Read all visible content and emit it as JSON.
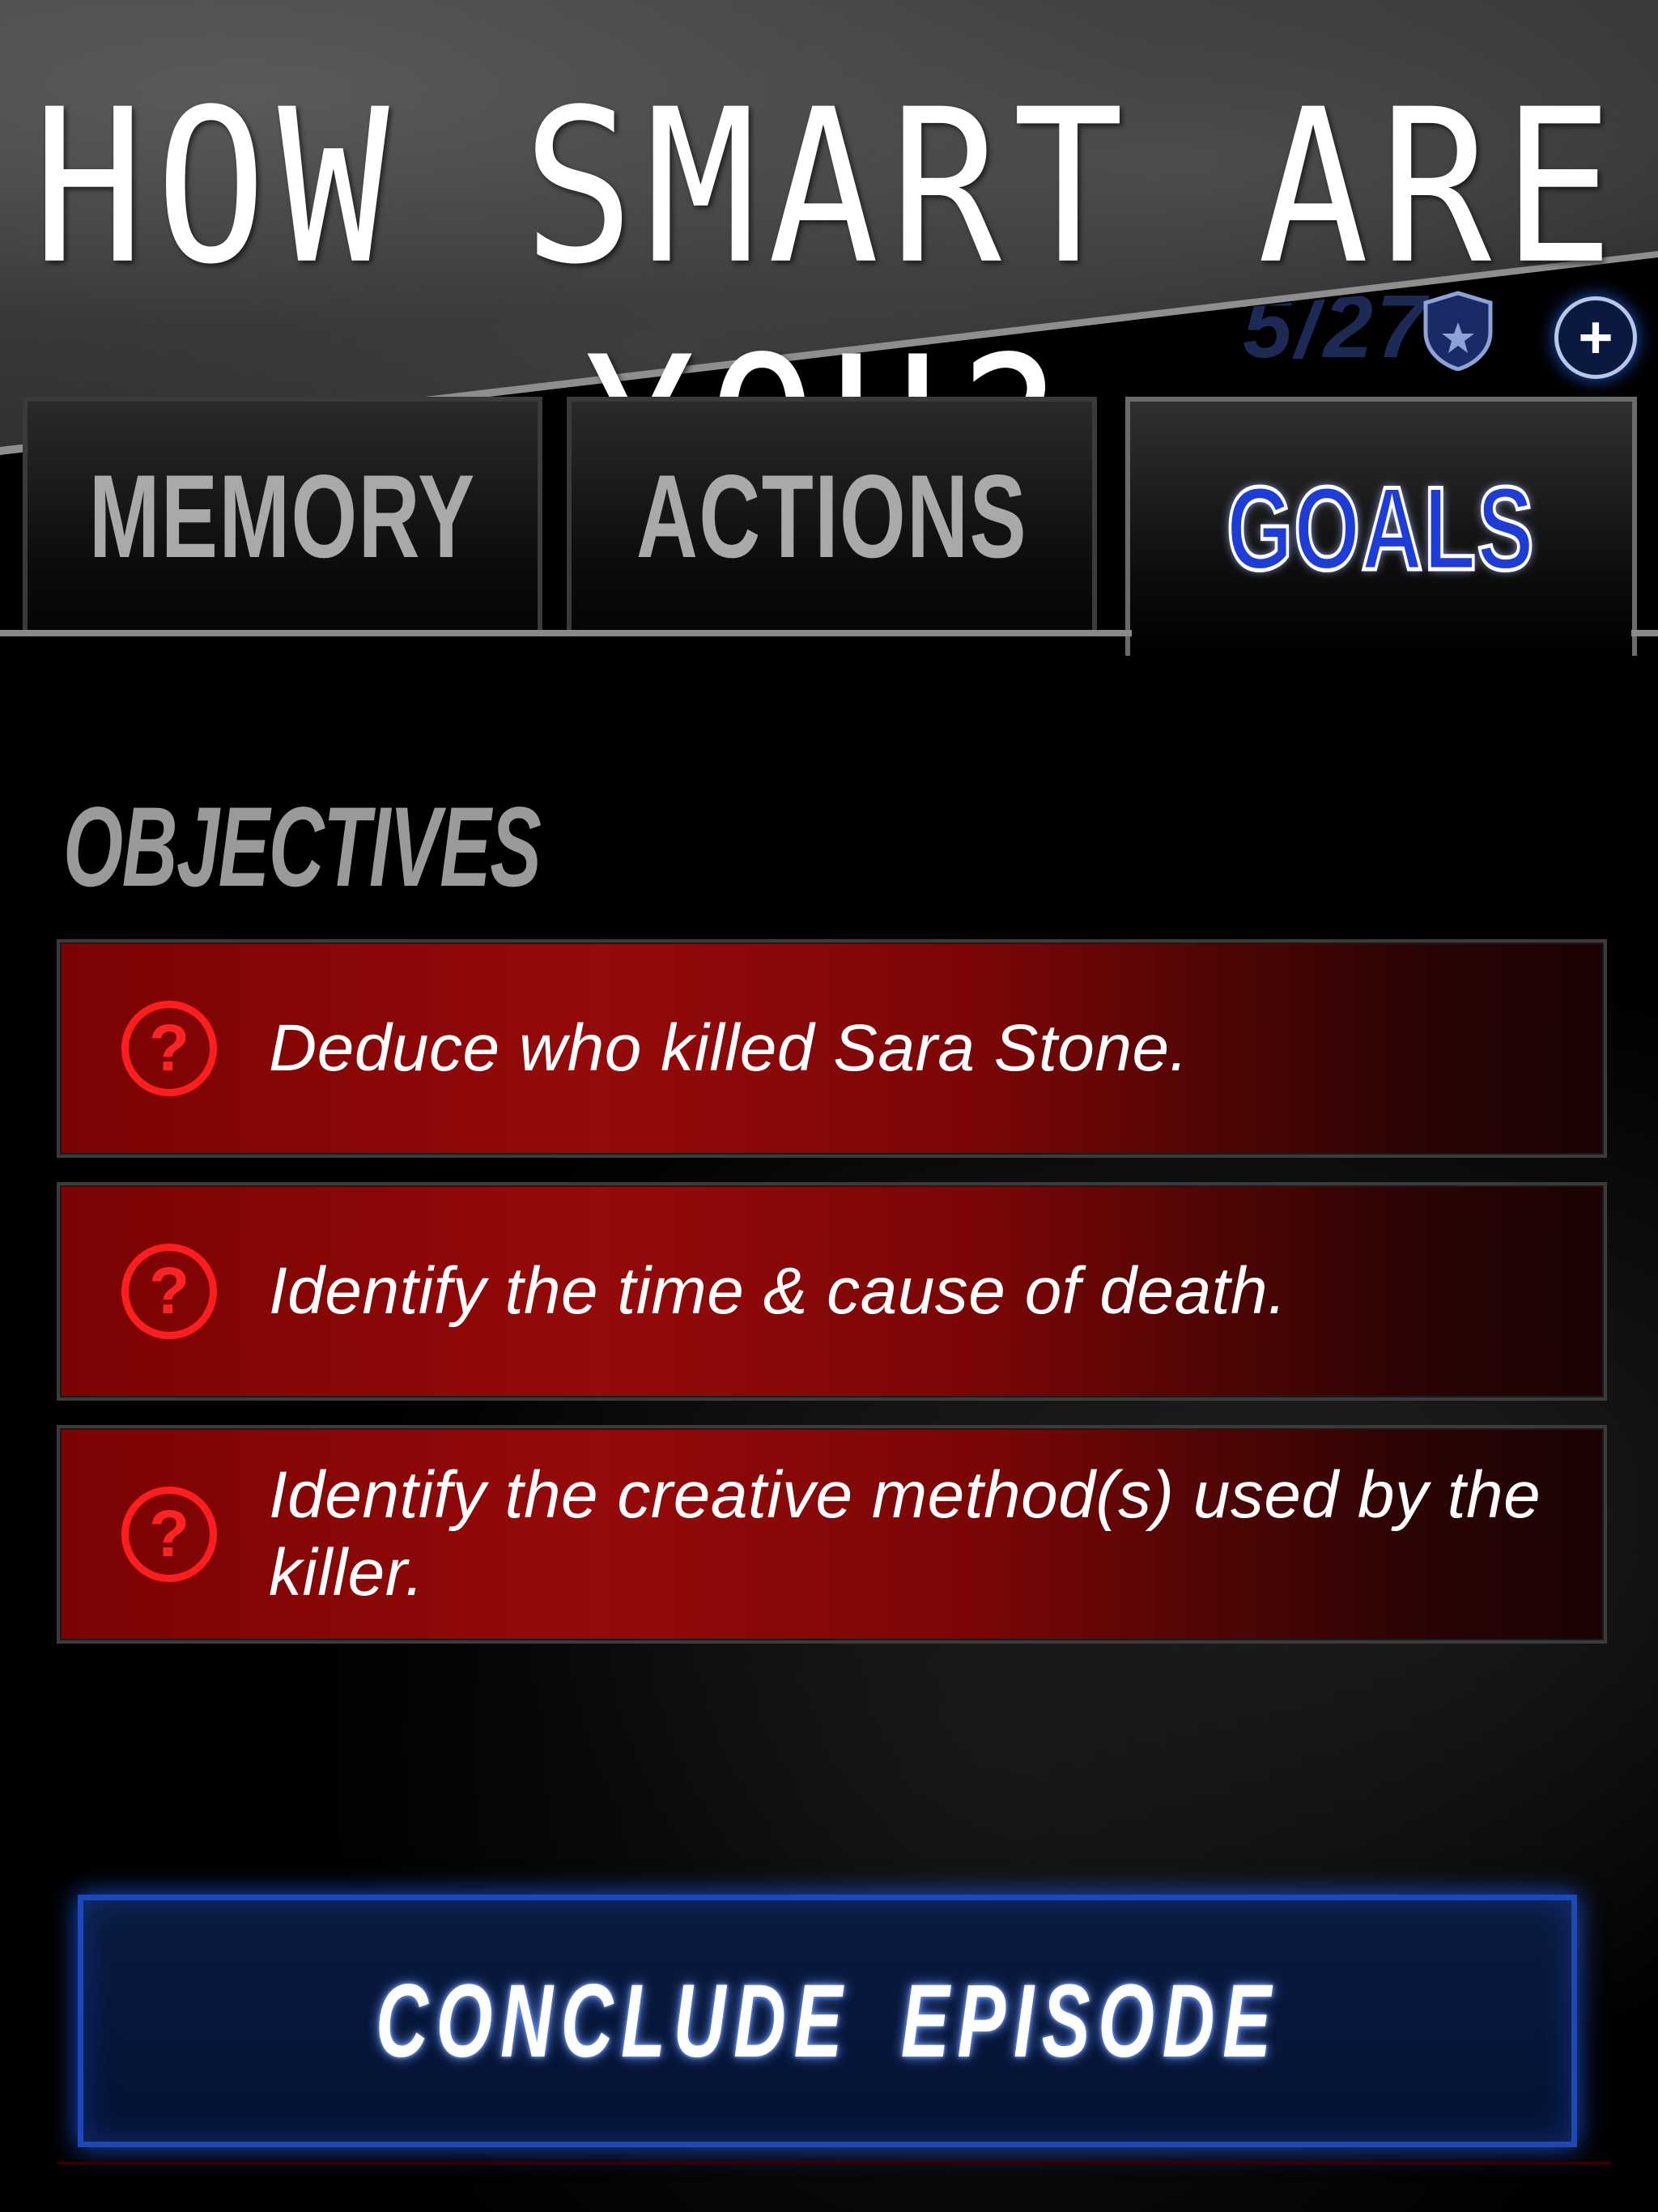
{
  "promo": {
    "title": "HOW SMART ARE YOU?"
  },
  "status": {
    "counter": "5/27"
  },
  "tabs": [
    {
      "label": "MEMORY",
      "active": false
    },
    {
      "label": "ACTIONS",
      "active": false
    },
    {
      "label": "GOALS",
      "active": true
    }
  ],
  "objectives": {
    "heading": "OBJECTIVES",
    "items": [
      {
        "text": "Deduce who killed Sara Stone.",
        "icon": "question-icon"
      },
      {
        "text": "Identify the time & cause of death.",
        "icon": "question-icon"
      },
      {
        "text": "Identify the creative method(s) used by the killer.",
        "icon": "question-icon"
      }
    ]
  },
  "actions": {
    "conclude_label": "CONCLUDE EPISODE"
  },
  "icons": {
    "badge": "shield-star-icon",
    "add": "plus-icon",
    "objective": "question-icon"
  },
  "colors": {
    "accent_blue": "#1e3cd6",
    "objective_red": "#950a0a",
    "icon_red": "#ff1e1e"
  }
}
